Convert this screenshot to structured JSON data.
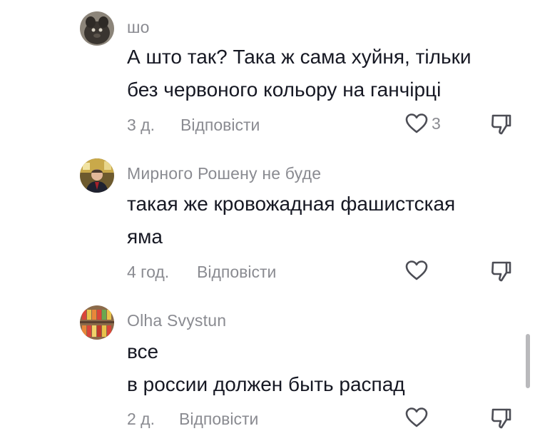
{
  "comments": [
    {
      "username": "шо",
      "text_lines": [
        "А што так? Така ж сама хуйня, тільки",
        "без червоного кольору на ганчірці"
      ],
      "time": "3 д.",
      "reply_label": "Відповісти",
      "likes": "3",
      "avatar_icon": "dark-animal-avatar"
    },
    {
      "username": "Мирного Рошену не буде",
      "text_lines": [
        "такая же кровожадная фашистская",
        "яма"
      ],
      "time": "4 год.",
      "reply_label": "Відповісти",
      "likes": "",
      "avatar_icon": "man-in-suit-avatar"
    },
    {
      "username": "Olha Svystun",
      "text_lines": [
        "все",
        "в россии должен быть распад"
      ],
      "time": "2 д.",
      "reply_label": "Відповісти",
      "likes": "",
      "avatar_icon": "colorful-shelves-avatar"
    }
  ],
  "icons": {
    "like": "heart-outline-icon",
    "dislike": "thumbs-down-outline-icon"
  },
  "colors": {
    "text": "#161823",
    "secondary": "#8a8b91",
    "scrollbar": "#b9b9bc"
  }
}
